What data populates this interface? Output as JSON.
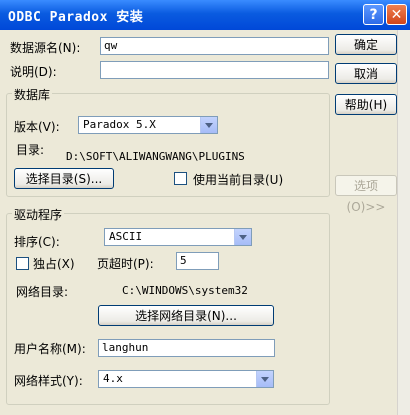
{
  "window": {
    "title": "ODBC Paradox 安装",
    "help_icon": "?",
    "close_icon": "✕"
  },
  "fields": {
    "dsn_label": "数据源名(N):",
    "dsn_value": "qw",
    "desc_label": "说明(D):",
    "desc_value": ""
  },
  "buttons": {
    "ok": "确定",
    "cancel": "取消",
    "help": "帮助(H)",
    "options": "选项(O)>>",
    "select_dir": "选择目录(S)...",
    "select_net_dir": "选择网络目录(N)..."
  },
  "database": {
    "legend": "数据库",
    "version_label": "版本(V):",
    "version_value": "Paradox 5.X",
    "dir_label": "目录:",
    "dir_value": "D:\\SOFT\\ALIWANGWANG\\PLUGINS",
    "use_current_label": "使用当前目录(U)"
  },
  "driver": {
    "legend": "驱动程序",
    "collate_label": "排序(C):",
    "collate_value": "ASCII",
    "exclusive_label": "独占(X)",
    "page_timeout_label": "页超时(P):",
    "page_timeout_value": "5",
    "net_dir_label": "网络目录:",
    "net_dir_value": "C:\\WINDOWS\\system32",
    "username_label": "用户名称(M):",
    "username_value": "langhun",
    "net_style_label": "网络样式(Y):",
    "net_style_value": "4.x"
  }
}
